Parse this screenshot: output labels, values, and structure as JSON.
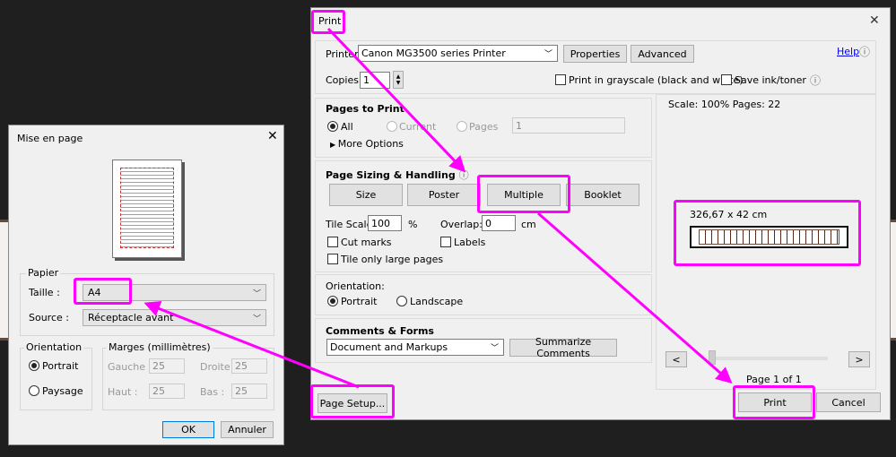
{
  "page_setup": {
    "title": "Mise en page",
    "papier_label": "Papier",
    "taille_label": "Taille :",
    "taille_value": "A4",
    "source_label": "Source :",
    "source_value": "Réceptacle avant",
    "orientation_label": "Orientation",
    "portrait": "Portrait",
    "paysage": "Paysage",
    "marges_label": "Marges (millimètres)",
    "gauche_label": "Gauche :",
    "gauche": "25",
    "droite_label": "Droite :",
    "droite": "25",
    "haut_label": "Haut :",
    "haut": "25",
    "bas_label": "Bas :",
    "bas": "25",
    "ok": "OK",
    "annuler": "Annuler"
  },
  "print": {
    "title": "Print",
    "help": "Help",
    "printer_label": "Printer:",
    "printer_value": "Canon MG3500 series Printer",
    "properties": "Properties",
    "advanced": "Advanced",
    "copies_label": "Copies:",
    "copies": "1",
    "grayscale": "Print in grayscale (black and white)",
    "save_ink": "Save ink/toner",
    "pages_heading": "Pages to Print",
    "all": "All",
    "current": "Current",
    "pages": "Pages",
    "pages_value": "1",
    "more_options": "More Options",
    "sizing_heading": "Page Sizing & Handling",
    "size": "Size",
    "poster": "Poster",
    "multiple": "Multiple",
    "booklet": "Booklet",
    "tile_scale_label": "Tile Scale:",
    "tile_scale": "100",
    "percent": "%",
    "overlap_label": "Overlap:",
    "overlap": "0",
    "cm": "cm",
    "cut_marks": "Cut marks",
    "labels": "Labels",
    "tile_large": "Tile only large pages",
    "orientation_label": "Orientation:",
    "portrait": "Portrait",
    "landscape": "Landscape",
    "comments_heading": "Comments & Forms",
    "comments_value": "Document and Markups",
    "summarize": "Summarize Comments",
    "scale_info": "Scale: 100% Pages: 22",
    "preview_size": "326,67 x 42 cm",
    "prev": "<",
    "next": ">",
    "page_info": "Page 1 of 1",
    "page_setup": "Page Setup...",
    "print_btn": "Print",
    "cancel": "Cancel"
  },
  "colors": {
    "annotation": "#ff00ff",
    "link": "#0000ee"
  }
}
